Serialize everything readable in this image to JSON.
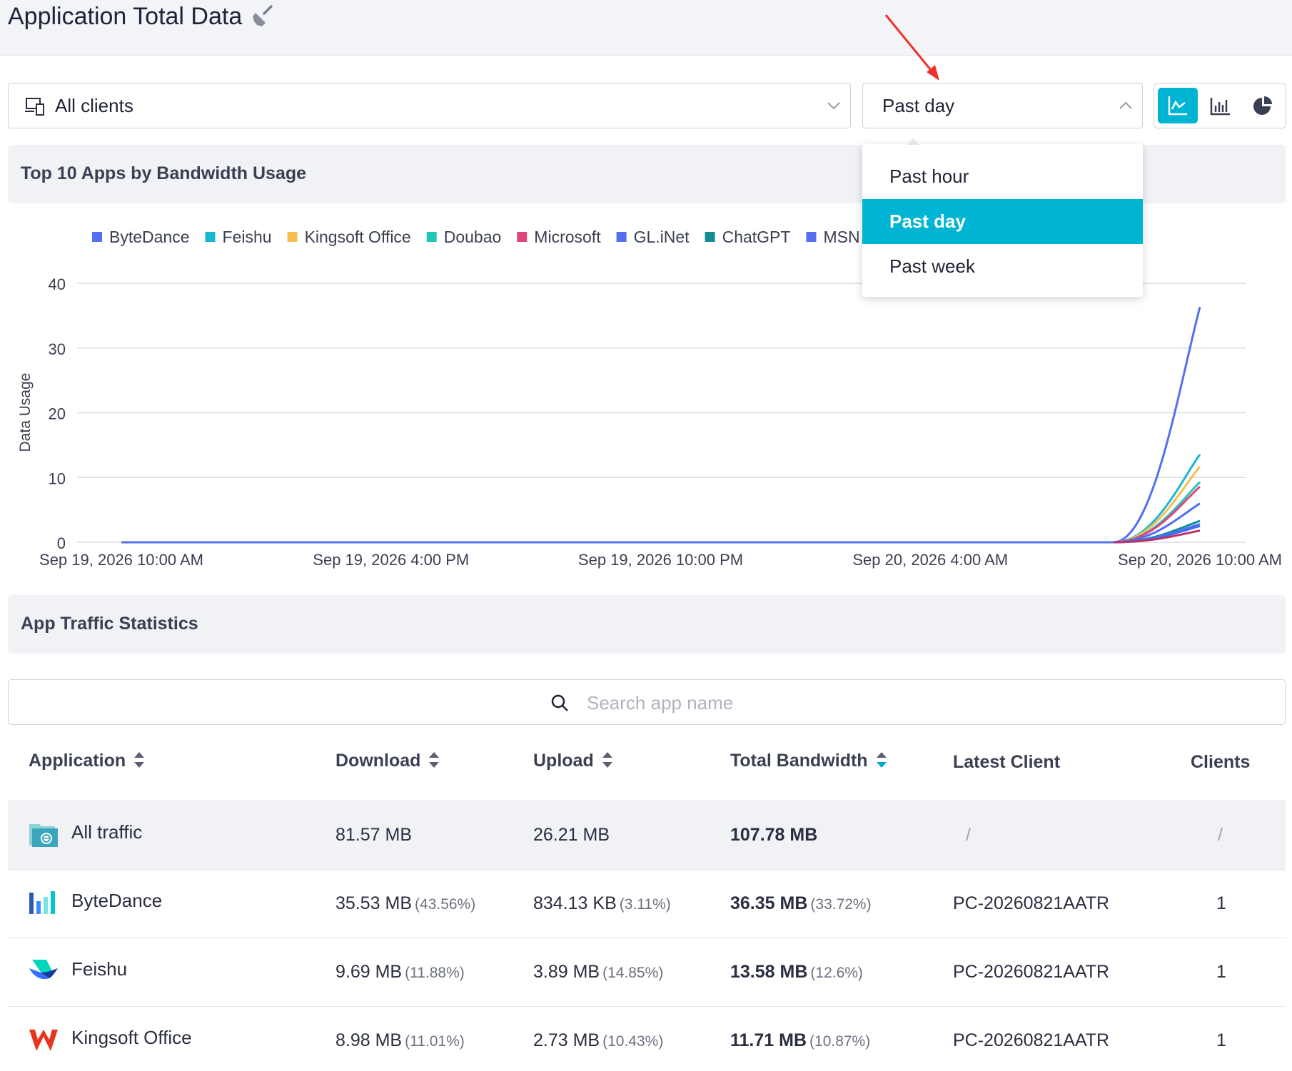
{
  "header": {
    "title": "Application Total Data"
  },
  "filters": {
    "clients": {
      "value": "All clients"
    },
    "range": {
      "value": "Past day",
      "options": [
        "Past hour",
        "Past day",
        "Past week"
      ]
    }
  },
  "chart_section": {
    "title": "Top 10 Apps by Bandwidth Usage"
  },
  "stats_section": {
    "title": "App Traffic Statistics"
  },
  "search": {
    "placeholder": "Search app name"
  },
  "chart_data": {
    "type": "line",
    "ylabel": "Data Usage",
    "ylim": [
      0,
      40
    ],
    "yticks": [
      "0",
      "10",
      "20",
      "30",
      "40"
    ],
    "xticks": [
      "Sep 19, 2026 10:00 AM",
      "Sep 19, 2026 4:00 PM",
      "Sep 19, 2026 10:00 PM",
      "Sep 20, 2026 4:00 AM",
      "Sep 20, 2026 10:00 AM"
    ],
    "legend_position": "top",
    "series": [
      {
        "name": "ByteDance",
        "color": "#5470f0",
        "end_value": 36.35
      },
      {
        "name": "Feishu",
        "color": "#19b8d2",
        "end_value": 13.58
      },
      {
        "name": "Kingsoft Office",
        "color": "#f5bf4f",
        "end_value": 11.71
      },
      {
        "name": "Doubao",
        "color": "#22c7b8",
        "end_value": 9.3
      },
      {
        "name": "Microsoft",
        "color": "#e0457b",
        "end_value": 8.6
      },
      {
        "name": "GL.iNet",
        "color": "#5470f0",
        "end_value": 6.0
      },
      {
        "name": "ChatGPT",
        "color": "#128c96",
        "end_value": 3.3
      },
      {
        "name": "MSN",
        "color": "#5470f0",
        "end_value": 2.8
      },
      {
        "name": "",
        "color": "#3a6df0",
        "end_value": 2.5
      },
      {
        "name": "",
        "color": "#c0306a",
        "end_value": 1.8
      }
    ]
  },
  "table": {
    "columns": [
      "Application",
      "Download",
      "Upload",
      "Total Bandwidth",
      "Latest Client",
      "Clients"
    ],
    "rows": [
      {
        "app": "All traffic",
        "download": "81.57 MB",
        "download_pct": "",
        "upload": "26.21 MB",
        "upload_pct": "",
        "total": "107.78 MB",
        "total_pct": "",
        "latest_client": "/",
        "clients": "/"
      },
      {
        "app": "ByteDance",
        "download": "35.53 MB",
        "download_pct": "(43.56%)",
        "upload": "834.13 KB",
        "upload_pct": "(3.11%)",
        "total": "36.35 MB",
        "total_pct": "(33.72%)",
        "latest_client": "PC-20260821AATR",
        "clients": "1"
      },
      {
        "app": "Feishu",
        "download": "9.69 MB",
        "download_pct": "(11.88%)",
        "upload": "3.89 MB",
        "upload_pct": "(14.85%)",
        "total": "13.58 MB",
        "total_pct": "(12.6%)",
        "latest_client": "PC-20260821AATR",
        "clients": "1"
      },
      {
        "app": "Kingsoft Office",
        "download": "8.98 MB",
        "download_pct": "(11.01%)",
        "upload": "2.73 MB",
        "upload_pct": "(10.43%)",
        "total": "11.71 MB",
        "total_pct": "(10.87%)",
        "latest_client": "PC-20260821AATR",
        "clients": "1"
      }
    ]
  }
}
